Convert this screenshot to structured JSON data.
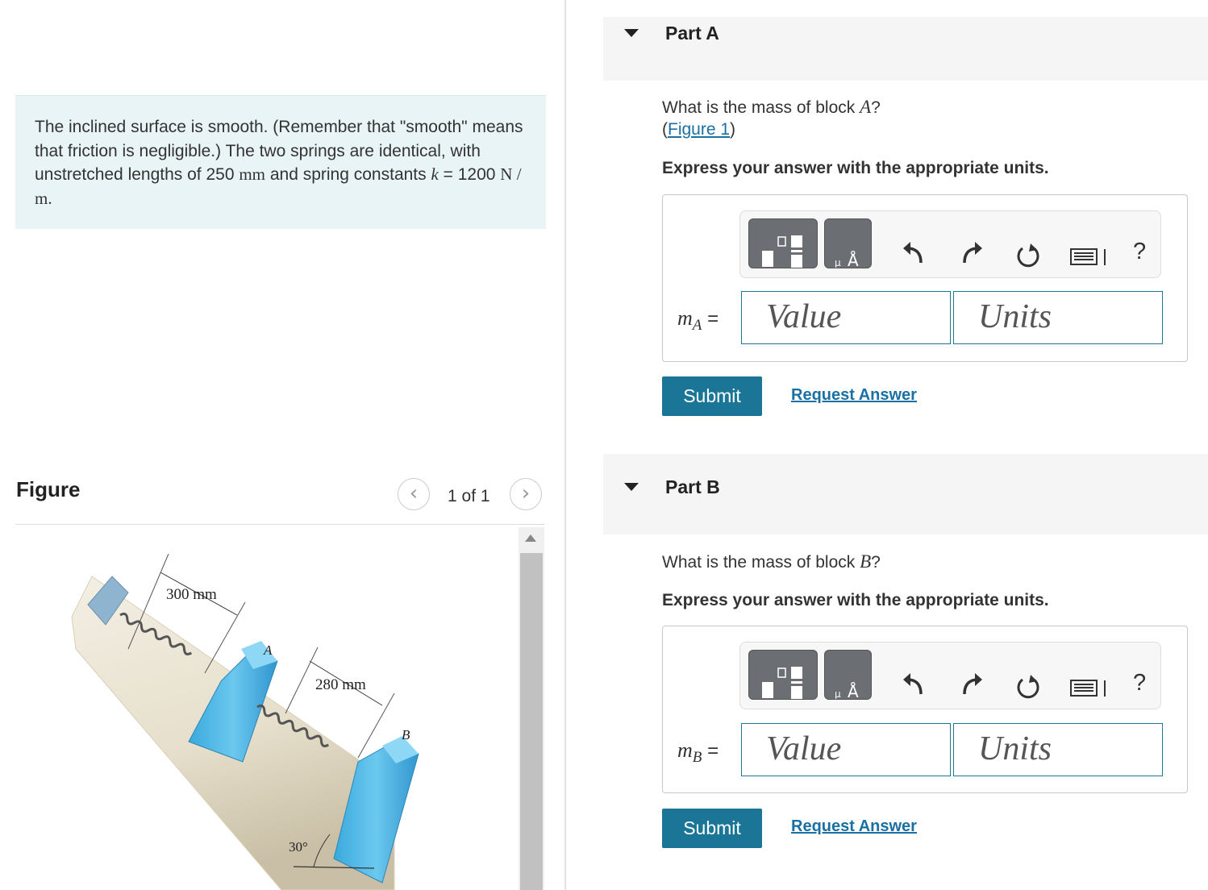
{
  "problem": {
    "text_1": "The inclined surface is smooth. (Remember that \"smooth\" means that friction is negligible.) The two springs are identical, with unstretched lengths of 250 ",
    "mm_unit": "mm",
    "text_2": " and spring constants ",
    "k_symbol": "k",
    "k_eq": " = 1200 ",
    "k_units": "N / m",
    "period": "."
  },
  "figure": {
    "heading": "Figure",
    "pager": "1 of 1",
    "prev_glyph": "‹",
    "next_glyph": "›",
    "labels": {
      "dim1": "300 mm",
      "dim2": "280 mm",
      "block_a": "A",
      "block_b": "B",
      "angle": "30°"
    }
  },
  "parts": [
    {
      "title": "Part A",
      "question_prefix": "What is the mass of block ",
      "block": "A",
      "question_suffix": "?",
      "figure_link_open": "(",
      "figure_link": "Figure 1",
      "figure_link_close": ")",
      "instruction": "Express your answer with the appropriate units.",
      "var_main": "m",
      "var_sub": "A",
      "equals": "=",
      "value_placeholder": "Value",
      "units_placeholder": "Units",
      "submit": "Submit",
      "request": "Request Answer"
    },
    {
      "title": "Part B",
      "question_prefix": "What is the mass of block ",
      "block": "B",
      "question_suffix": "?",
      "instruction": "Express your answer with the appropriate units.",
      "var_main": "m",
      "var_sub": "B",
      "equals": "=",
      "value_placeholder": "Value",
      "units_placeholder": "Units",
      "submit": "Submit",
      "request": "Request Answer"
    }
  ],
  "toolbar": {
    "templates_icon": "fraction-template-icon",
    "units_icon": "angstrom-units-icon",
    "undo_icon": "undo-icon",
    "redo_icon": "redo-icon",
    "reset_icon": "reset-icon",
    "keyboard_icon": "keyboard-icon",
    "help": "?"
  }
}
